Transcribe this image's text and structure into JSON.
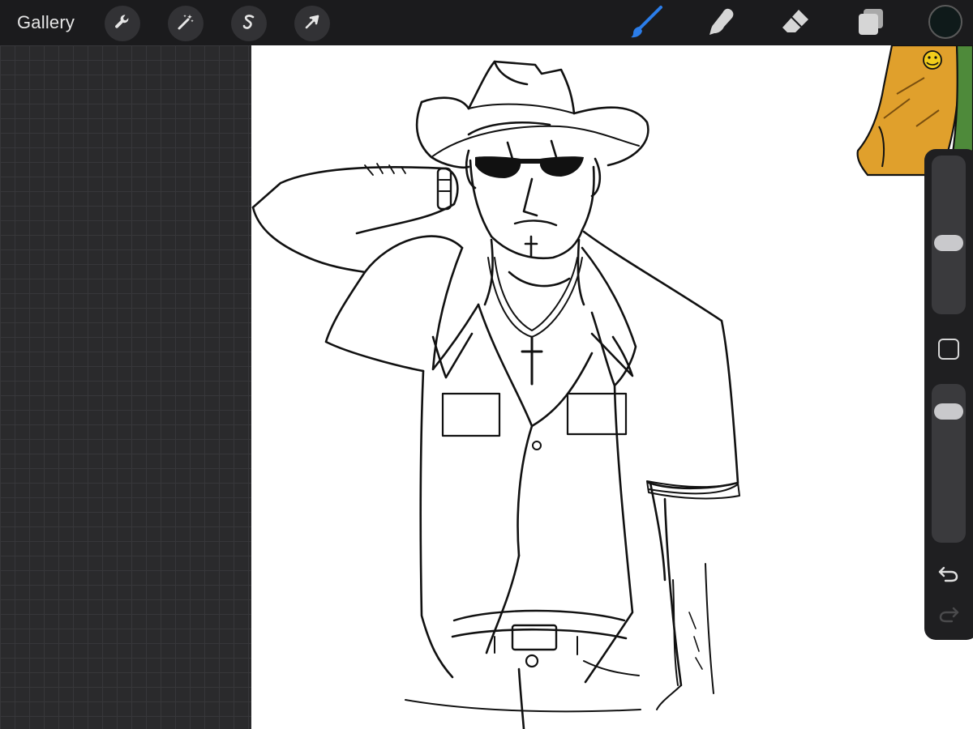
{
  "app": {
    "gallery_label": "Gallery"
  },
  "toolbar": {
    "left_tools": [
      {
        "name": "actions",
        "icon": "wrench-icon"
      },
      {
        "name": "adjustments",
        "icon": "magic-wand-icon"
      },
      {
        "name": "selection",
        "icon": "selection-s-icon"
      },
      {
        "name": "transform",
        "icon": "arrow-cursor-icon"
      }
    ],
    "right_tools": [
      {
        "name": "brush",
        "icon": "brush-icon",
        "active": true
      },
      {
        "name": "smudge",
        "icon": "smudge-finger-icon",
        "active": false
      },
      {
        "name": "eraser",
        "icon": "eraser-icon",
        "active": false
      },
      {
        "name": "layers",
        "icon": "layers-icon",
        "active": false
      }
    ],
    "current_color": "#0f1a1a"
  },
  "sidebar": {
    "brush_size_level": 0.45,
    "brush_opacity_level": 0.82,
    "modify_icon": "square-icon",
    "undo_icon": "undo-arrow-icon",
    "redo_icon": "redo-arrow-icon",
    "redo_enabled": false
  },
  "colors": {
    "active_tool": "#2b7de9",
    "toolbar_bg": "#1b1b1d",
    "canvas": "#ffffff",
    "ink": "#111111",
    "orange_clothing": "#e0a02c",
    "green_clothing": "#4e8a3a",
    "smiley": "#f2cc1b"
  }
}
